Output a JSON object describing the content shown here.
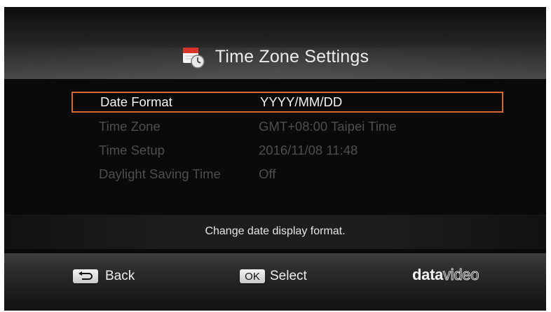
{
  "header": {
    "title": "Time Zone Settings",
    "icon": "calendar-clock-icon"
  },
  "settings": [
    {
      "label": "Date Format",
      "value": "YYYY/MM/DD",
      "selected": true
    },
    {
      "label": "Time Zone",
      "value": "GMT+08:00 Taipei Time",
      "selected": false
    },
    {
      "label": "Time Setup",
      "value": "2016/11/08 11:48",
      "selected": false
    },
    {
      "label": "Daylight Saving Time",
      "value": "Off",
      "selected": false
    }
  ],
  "hint": "Change date display format.",
  "footer": {
    "back_label": "Back",
    "ok_key": "OK",
    "select_label": "Select",
    "logo_bold": "data",
    "logo_light": "video"
  },
  "colors": {
    "selection_border": "#d8692b",
    "active_text": "#f4f4f4",
    "dim_text": "#4e4e4e"
  }
}
